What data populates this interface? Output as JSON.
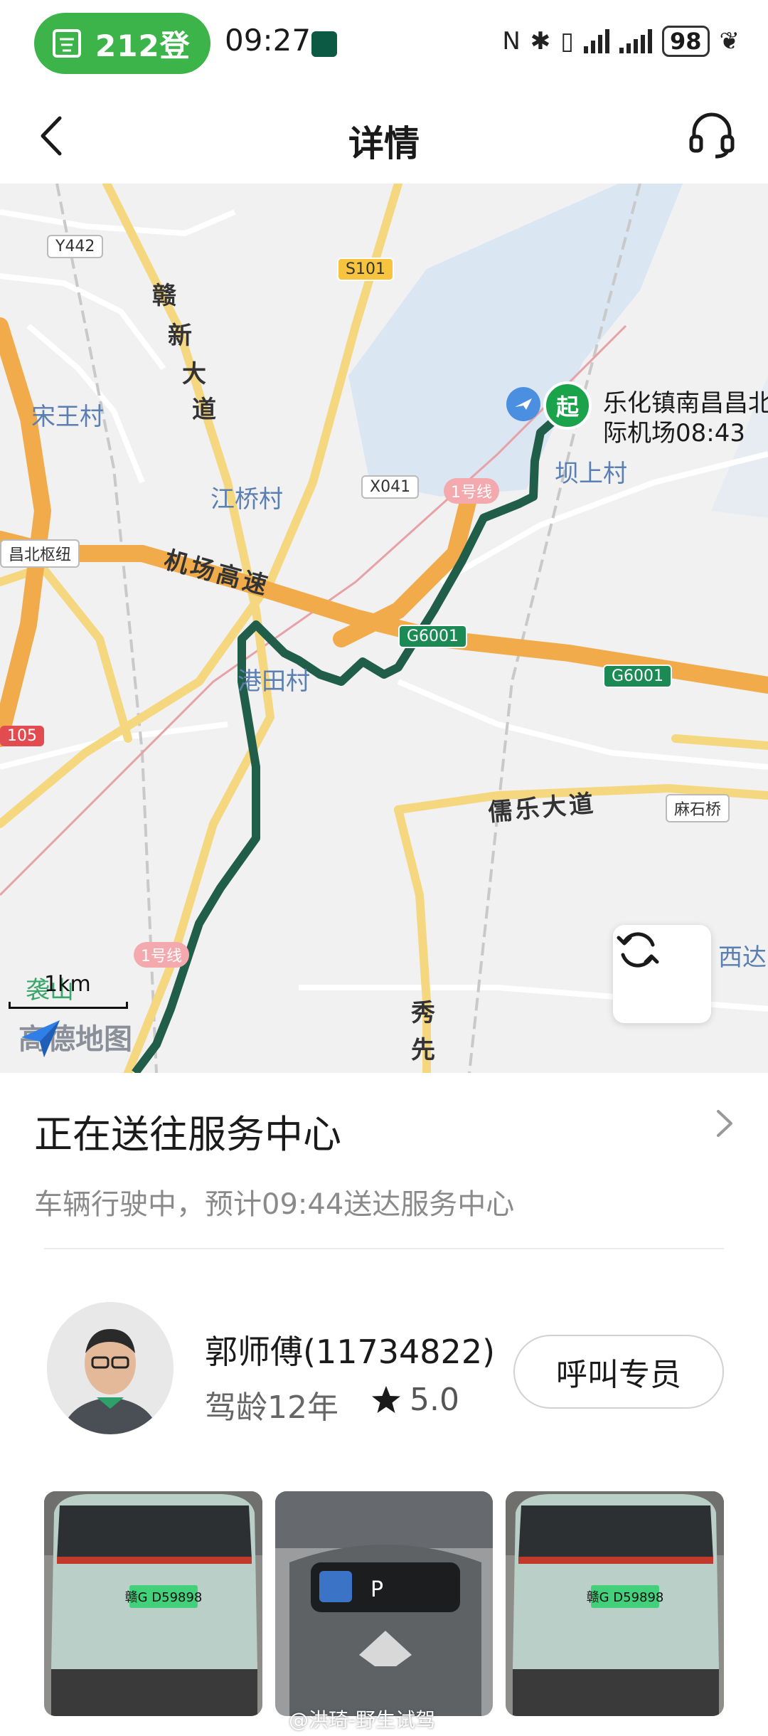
{
  "status_bar": {
    "boarding_text": "212登",
    "time": "09:27",
    "battery": "98"
  },
  "header": {
    "title": "详情"
  },
  "map": {
    "start_marker": "起",
    "start_label_line1": "乐化镇南昌昌北",
    "start_label_line2": "际机场08:43",
    "place_labels": [
      "宋王村",
      "坝上村",
      "江桥村",
      "港田村",
      "西达",
      "袭山",
      "秀",
      "先"
    ],
    "road_labels": [
      "赣",
      "新",
      "大",
      "道",
      "机场高速",
      "儒乐大道"
    ],
    "road_tags": {
      "y442": "Y442",
      "s101": "S101",
      "x041": "X041",
      "line1_a": "1号线",
      "line1_b": "1号线",
      "g6001_a": "G6001",
      "g6001_b": "G6001",
      "hub": "昌北枢纽",
      "masq": "麻石桥",
      "r105": "105"
    },
    "scale": "1km",
    "logo_text": "高德地图",
    "route_color": "#205e4a",
    "highway_color": "#f2ab4a"
  },
  "status": {
    "title": "正在送往服务中心",
    "subtitle": "车辆行驶中，预计09:44送达服务中心"
  },
  "driver": {
    "name": "郭师傅(11734822)",
    "experience": "驾龄12年",
    "rating": "5.0",
    "call_button": "呼叫专员"
  },
  "photos": {
    "plate_1": "赣G D59898",
    "plate_2": "赣G D59898",
    "gear": "P"
  },
  "watermark": "@洪琦-野生试驾"
}
